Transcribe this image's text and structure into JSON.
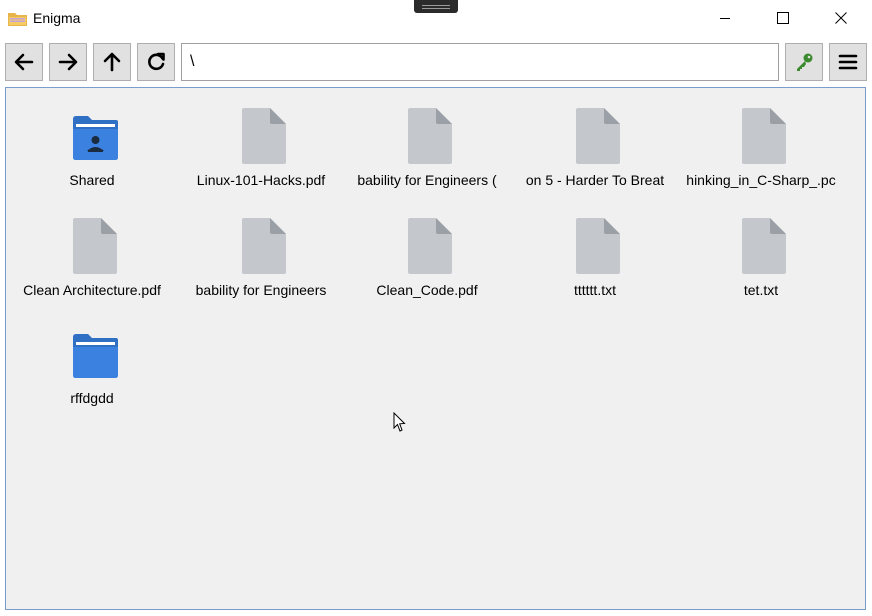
{
  "window": {
    "title": "Enigma",
    "icon": "folder-icon"
  },
  "toolbar": {
    "back_icon": "arrow-left-icon",
    "forward_icon": "arrow-right-icon",
    "up_icon": "arrow-up-icon",
    "refresh_icon": "refresh-icon",
    "path": "\\",
    "key_icon": "key-icon",
    "menu_icon": "hamburger-menu-icon",
    "key_color": "#3c8a2e"
  },
  "files": [
    {
      "name": "Shared",
      "type": "shared-folder"
    },
    {
      "name": "Linux-101-Hacks.pdf",
      "type": "file"
    },
    {
      "name": "bability for Engineers (",
      "type": "file"
    },
    {
      "name": "on 5 - Harder To Breat",
      "type": "file"
    },
    {
      "name": "hinking_in_C-Sharp_.pc",
      "type": "file"
    },
    {
      "name": "Clean Architecture.pdf",
      "type": "file"
    },
    {
      "name": "bability for Engineers",
      "type": "file"
    },
    {
      "name": "Clean_Code.pdf",
      "type": "file"
    },
    {
      "name": "tttttt.txt",
      "type": "file"
    },
    {
      "name": "tet.txt",
      "type": "file"
    },
    {
      "name": "rffdgdd",
      "type": "folder"
    }
  ],
  "colors": {
    "folder": "#3b82e0",
    "folder_dark": "#2f6fc4",
    "file": "#c4c8cc",
    "file_fold": "#9aa0a6",
    "content_bg": "#f0f0f0",
    "content_border": "#7a9ccc"
  }
}
